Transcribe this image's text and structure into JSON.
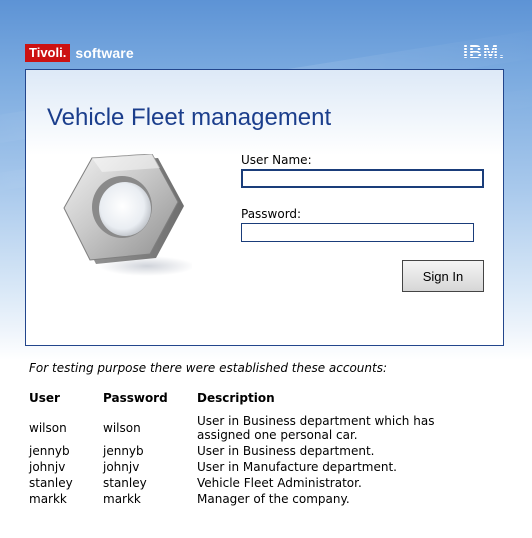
{
  "branding": {
    "tivoli_label": "Tivoli.",
    "software_label": "software",
    "ibm_label": "IBM."
  },
  "login": {
    "title": "Vehicle Fleet management",
    "username_label": "User Name:",
    "username_value": "",
    "password_label": "Password:",
    "password_value": "",
    "sign_in_label": "Sign In"
  },
  "accounts": {
    "intro": "For testing purpose there were established these accounts:",
    "headers": {
      "user": "User",
      "password": "Password",
      "description": "Description"
    },
    "rows": [
      {
        "user": "wilson",
        "password": "wilson",
        "description": "User in Business department which has assigned one personal car."
      },
      {
        "user": "jennyb",
        "password": "jennyb",
        "description": "User in Business department."
      },
      {
        "user": "johnjv",
        "password": "johnjv",
        "description": "User in Manufacture department."
      },
      {
        "user": "stanley",
        "password": "stanley",
        "description": "Vehicle Fleet Administrator."
      },
      {
        "user": "markk",
        "password": "markk",
        "description": "Manager of the company."
      }
    ]
  },
  "colors": {
    "brand_red": "#cc1111",
    "title_blue": "#1b3e8c",
    "panel_border": "#23468c"
  },
  "icons": {
    "illustration": "hex-nut-icon"
  }
}
